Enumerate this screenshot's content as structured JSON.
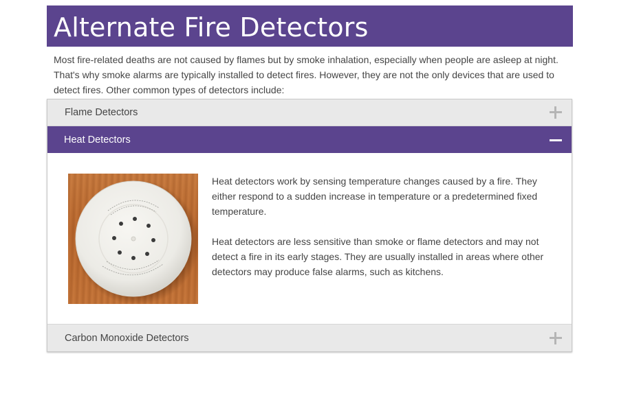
{
  "page": {
    "title": "Alternate Fire Detectors",
    "intro": "Most fire-related deaths are not caused by flames but by smoke inhalation, especially when people are asleep at night. That's why smoke alarms are typically installed to detect fires. However, they are not the only devices that are used to detect fires. Other common types of detectors include:"
  },
  "accordion": {
    "items": [
      {
        "label": "Flame Detectors",
        "expanded": false,
        "icon": "plus-icon"
      },
      {
        "label": "Heat Detectors",
        "expanded": true,
        "icon": "minus-icon",
        "image_alt": "heat detector",
        "paragraphs": [
          "Heat detectors work by sensing temperature changes caused by a fire. They either respond to a sudden increase in temperature or a predetermined fixed temperature.",
          "Heat detectors are less sensitive than smoke or flame detectors and may not detect a fire in its early stages. They are usually installed in areas where other detectors may produce false alarms, such as kitchens."
        ]
      },
      {
        "label": "Carbon Monoxide Detectors",
        "expanded": false,
        "icon": "plus-icon"
      }
    ]
  },
  "colors": {
    "accent": "#5b448e",
    "header_bg": "#e9e9e9",
    "text": "#444444"
  }
}
